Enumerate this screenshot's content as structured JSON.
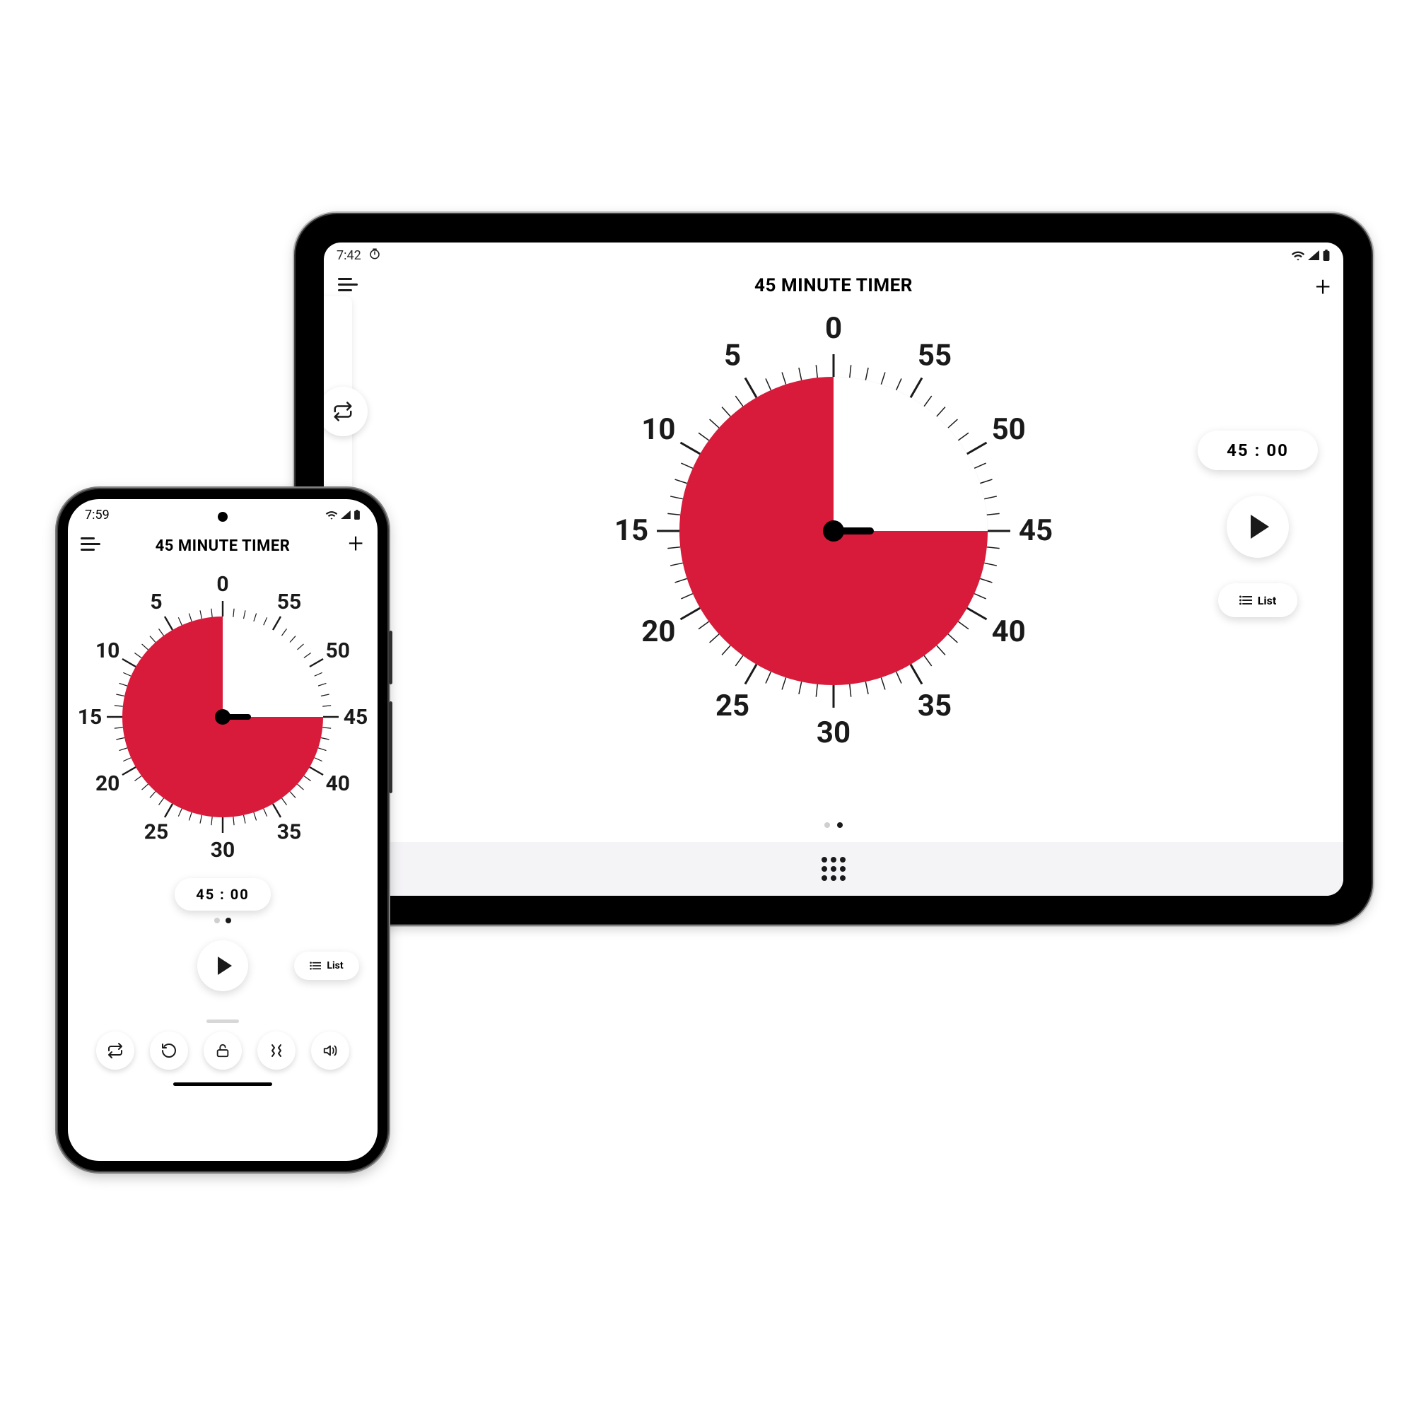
{
  "tablet": {
    "status": {
      "time": "7:42",
      "wifi": true,
      "signal": true,
      "battery": true,
      "app_icon": "timer-icon"
    },
    "title": "45 MINUTE TIMER",
    "time_display": "45 : 00",
    "list_label": "List",
    "dial": {
      "max": 60,
      "value": 45,
      "labels": [
        "0",
        "55",
        "50",
        "45",
        "40",
        "35",
        "30",
        "25",
        "20",
        "15",
        "10",
        "5"
      ],
      "fill_color": "#d81b3a",
      "start_angle": 0,
      "end_angle": 270
    },
    "actions": {
      "menu": "menu",
      "add": "+",
      "play": "play",
      "repeat": "repeat",
      "apps": "apps"
    },
    "page_dot_active": 1,
    "page_dot_count": 2
  },
  "phone": {
    "status": {
      "time": "7:59",
      "wifi": true,
      "signal": true,
      "battery": true
    },
    "title": "45 MINUTE TIMER",
    "time_display": "45 : 00",
    "list_label": "List",
    "dial": {
      "max": 60,
      "value": 45,
      "labels": [
        "0",
        "55",
        "50",
        "45",
        "40",
        "35",
        "30",
        "25",
        "20",
        "15",
        "10",
        "5"
      ],
      "fill_color": "#d81b3a",
      "start_angle": 0,
      "end_angle": 270
    },
    "toolbar": [
      "repeat",
      "restart",
      "lock",
      "vibrate",
      "sound"
    ],
    "actions": {
      "menu": "menu",
      "add": "+",
      "play": "play"
    },
    "page_dot_active": 1,
    "page_dot_count": 2
  },
  "colors": {
    "accent": "#d81b3a",
    "ink": "#1a1a1a"
  }
}
